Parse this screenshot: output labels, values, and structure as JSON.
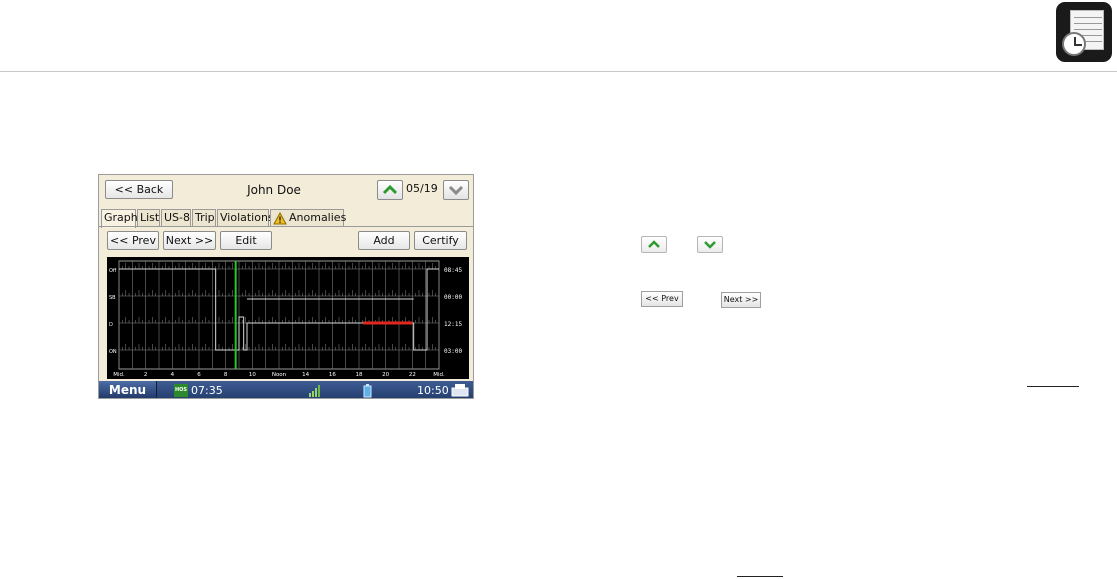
{
  "device": {
    "back_label": "<< Back",
    "driver_name": "John Doe",
    "date": "05/19",
    "tabs": [
      "Graph",
      "List",
      "US-8",
      "Trip",
      "Violations",
      "Anomalies"
    ],
    "prev_label": "<< Prev",
    "next_label": "Next >>",
    "edit_label": "Edit",
    "add_label": "Add",
    "certify_label": "Certify",
    "graph": {
      "row_labels": [
        "Off",
        "SB",
        "D",
        "ON"
      ],
      "right_totals": [
        "08:45",
        "00:00",
        "12:15",
        "03:00"
      ],
      "x_labels": [
        "Mid.",
        "2",
        "4",
        "6",
        "8",
        "10",
        "Noon",
        "14",
        "16",
        "18",
        "20",
        "22",
        "Mid."
      ]
    },
    "status": {
      "menu_label": "Menu",
      "hos_badge": "HOS",
      "hos_time": "07:35",
      "clock": "10:50"
    }
  },
  "doc": {
    "inline_prev": "<< Prev",
    "inline_next": "Next >>"
  },
  "colors": {
    "screen_bg": "#f2ecd8",
    "graph_bg": "#000000",
    "current_time_line": "#27c927",
    "violation_line": "#e0281e",
    "status_bar": "#2a467a",
    "arrow_green": "#2f9a2f"
  },
  "icons": [
    "log-app-icon",
    "chevron-up-icon",
    "chevron-down-icon",
    "warning-icon",
    "signal-icon",
    "battery-phone-icon",
    "printer-icon"
  ]
}
